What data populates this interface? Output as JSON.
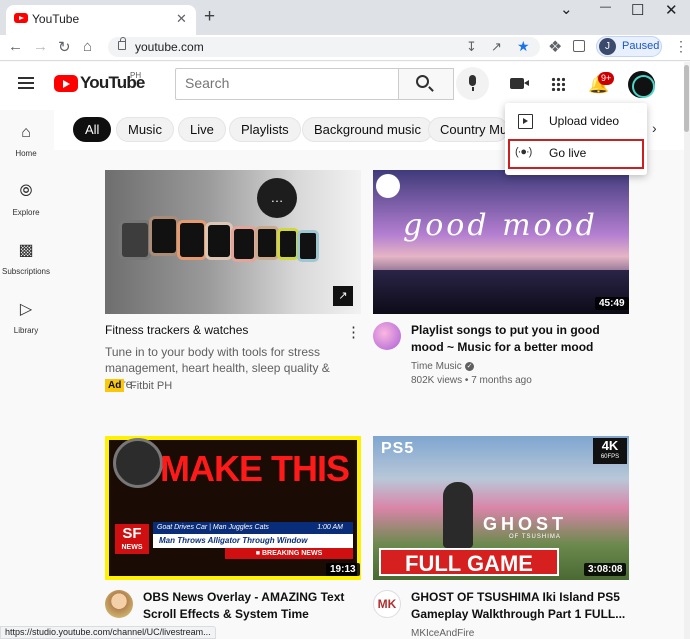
{
  "browser": {
    "tab_title": "YouTube",
    "tab_close": "✕",
    "new_tab": "+",
    "window_controls": {
      "chevron": "⌄",
      "minimize": "—",
      "maximize": "☐",
      "close": "✕"
    },
    "url": "youtube.com",
    "profile_initial": "J",
    "profile_status": "Paused",
    "status_bar_url": "https://studio.youtube.com/channel/UC/livestream..."
  },
  "header": {
    "logo_text": "YouTube",
    "region": "PH",
    "search_placeholder": "Search",
    "notification_count": "9+"
  },
  "sidebar": {
    "items": [
      {
        "label": "Home",
        "icon": "home-icon"
      },
      {
        "label": "Explore",
        "icon": "compass-icon"
      },
      {
        "label": "Subscriptions",
        "icon": "subscriptions-icon"
      },
      {
        "label": "Library",
        "icon": "library-icon"
      }
    ]
  },
  "chips": [
    "All",
    "Music",
    "Live",
    "Playlists",
    "Background music",
    "Country Mus"
  ],
  "create_menu": {
    "upload_label": "Upload video",
    "golive_label": "Go live"
  },
  "videos": [
    {
      "title": "Fitness trackers & watches",
      "description": "Tune in to your body with tools for stress management, heart health, sleep quality & more.",
      "ad_badge": "Ad",
      "channel": "Fitbit PH"
    },
    {
      "title": "Playlist songs to put you in good mood ~ Music for a better mood",
      "duration": "45:49",
      "channel": "Time Music",
      "meta": "802K views • 7 months ago",
      "thumb_text": "good mood"
    },
    {
      "title": "OBS News Overlay - AMAZING Text Scroll Effects & System Time",
      "duration": "19:13",
      "thumb_headline": "MAKE THIS",
      "ticker_top": "Goat Drives Car | Man Juggles Cats",
      "ticker_time": "1:00 AM",
      "ticker_main": "Man Throws Alligator Through Window",
      "ticker_breaking": "BREAKING NEWS",
      "sf_logo": "SF",
      "sf_sub": "NEWS"
    },
    {
      "title": "GHOST OF TSUSHIMA Iki Island PS5 Gameplay Walkthrough Part 1 FULL...",
      "duration": "3:08:08",
      "channel": "MKIceAndFire",
      "ps5": "PS5",
      "badge_4k": "4K",
      "badge_fps": "60FPS",
      "ghost": "GHOST",
      "tsushima": "OF TSUSHIMA",
      "full_game": "FULL GAME"
    }
  ]
}
